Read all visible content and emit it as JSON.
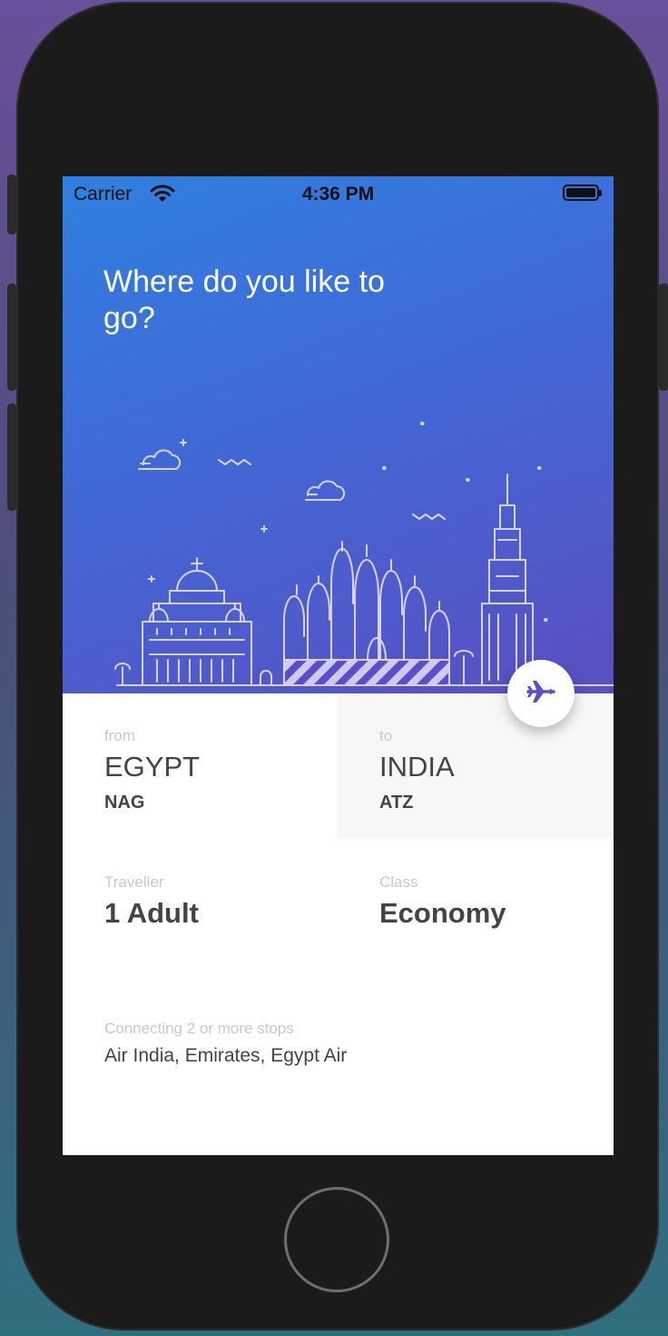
{
  "status_bar": {
    "carrier": "Carrier",
    "time": "4:36 PM"
  },
  "hero": {
    "headline": "Where do you like to go?"
  },
  "trip": {
    "from": {
      "label": "from",
      "country": "EGYPT",
      "code": "NAG"
    },
    "to": {
      "label": "to",
      "country": "INDIA",
      "code": "ATZ"
    }
  },
  "traveller": {
    "label": "Traveller",
    "value": "1 Adult"
  },
  "class": {
    "label": "Class",
    "value": "Economy"
  },
  "stops": {
    "label": "Connecting 2 or more stops",
    "airlines": "Air India, Emirates, Egypt Air"
  },
  "icons": {
    "fab": "airplane-icon",
    "wifi": "wifi-icon",
    "battery": "battery-icon"
  },
  "colors": {
    "gradient_start": "#2f80e0",
    "gradient_end": "#5a4fc2",
    "accent": "#5b4ec9",
    "panel": "#f7f7f6"
  }
}
